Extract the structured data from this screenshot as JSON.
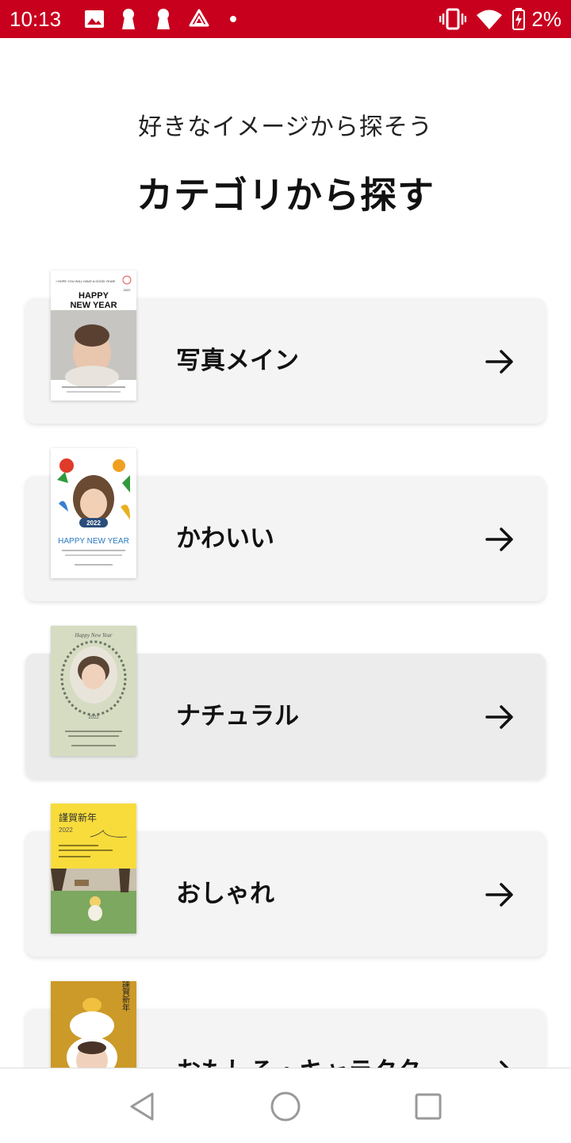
{
  "status_bar": {
    "time": "10:13",
    "battery_percent": "2%",
    "accent_color": "#c8001e",
    "icons": [
      "image-icon",
      "keyhole-icon",
      "keyhole-icon",
      "drive-icon",
      "dot-icon",
      "vibrate-icon",
      "wifi-icon",
      "battery-low-icon"
    ]
  },
  "header": {
    "subtitle": "好きなイメージから探そう",
    "title": "カテゴリから探す"
  },
  "categories": [
    {
      "label": "写真メイン",
      "thumb": {
        "top_text": "I HOPE YOU WILL HAVE A GOOD YEAR!",
        "year_small": "2022",
        "headline_1": "HAPPY",
        "headline_2": "NEW YEAR"
      }
    },
    {
      "label": "かわいい",
      "thumb": {
        "badge": "2022",
        "headline": "HAPPY NEW YEAR"
      }
    },
    {
      "label": "ナチュラル",
      "thumb": {
        "script": "Happy New Year",
        "year": "2022"
      }
    },
    {
      "label": "おしゃれ",
      "thumb": {
        "heading": "謹賀新年",
        "year": "2022"
      }
    },
    {
      "label": "おもしろ・キャラクター",
      "thumb": {
        "vertical_text": "謹賀新年"
      }
    }
  ],
  "nav": {
    "back": "back-icon",
    "home": "home-icon",
    "recents": "recents-icon"
  }
}
